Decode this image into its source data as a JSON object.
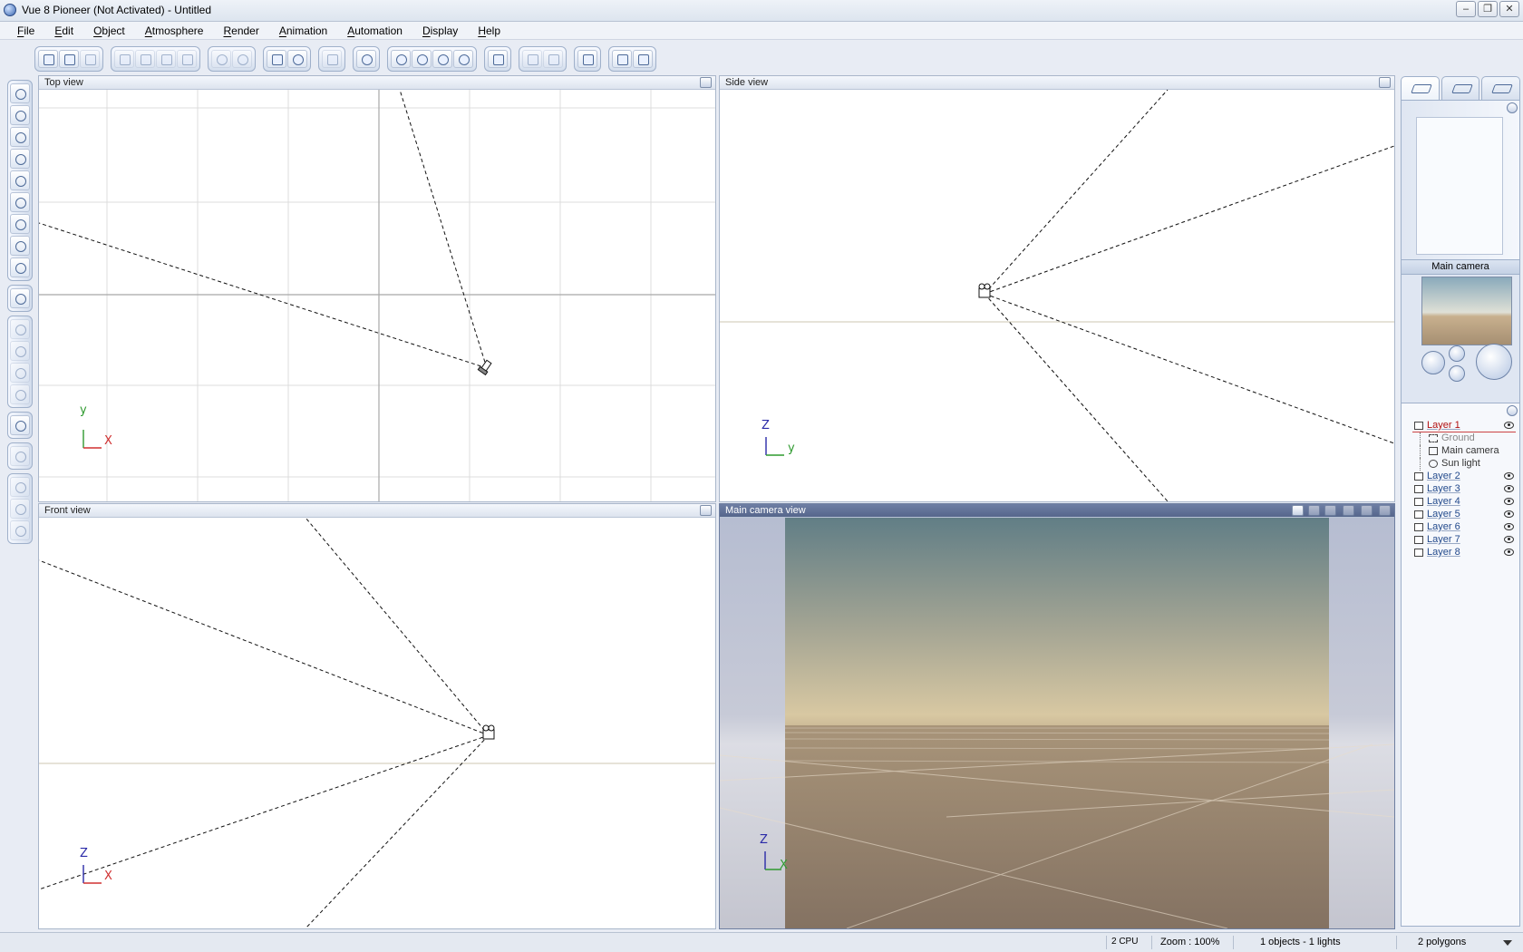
{
  "window": {
    "title": "Vue 8 Pioneer (Not Activated) - Untitled",
    "buttons": [
      "–",
      "❐",
      "✕"
    ]
  },
  "menu": [
    "File",
    "Edit",
    "Object",
    "Atmosphere",
    "Render",
    "Animation",
    "Automation",
    "Display",
    "Help"
  ],
  "viewports": {
    "top": {
      "title": "Top view",
      "axis_v": "y",
      "axis_h": "X"
    },
    "side": {
      "title": "Side view",
      "axis_v": "Z",
      "axis_h": "y"
    },
    "front": {
      "title": "Front view",
      "axis_v": "Z",
      "axis_h": "X"
    },
    "camera": {
      "title": "Main camera view",
      "axis_v": "Z",
      "axis_h": "X"
    }
  },
  "right_panel": {
    "camera_label": "Main camera",
    "layers": [
      {
        "name": "Layer 1",
        "active": true
      },
      {
        "name": "Layer 2"
      },
      {
        "name": "Layer 3"
      },
      {
        "name": "Layer 4"
      },
      {
        "name": "Layer 5"
      },
      {
        "name": "Layer 6"
      },
      {
        "name": "Layer 7"
      },
      {
        "name": "Layer 8"
      }
    ],
    "layer1_objects": [
      {
        "name": "Ground",
        "dim": true
      },
      {
        "name": "Main camera"
      },
      {
        "name": "Sun light"
      }
    ]
  },
  "status": {
    "cpu": "2 CPU",
    "zoom": "Zoom : 100%",
    "objects": "1 objects - 1 lights",
    "polygons": "2 polygons"
  },
  "colors": {
    "sky_top": "#617e86",
    "sky_horizon": "#d8c8a2",
    "ground": "#8c7a68",
    "axis_x": "#d03030",
    "axis_y": "#2f9a2f",
    "axis_z": "#2a2aa8",
    "active_layer": "#b10f0f"
  }
}
